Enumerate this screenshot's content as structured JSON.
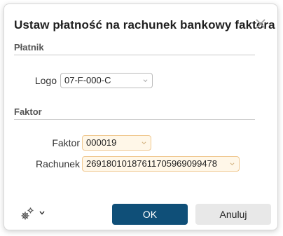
{
  "dialog": {
    "title": "Ustaw płatność na rachunek bankowy faktora",
    "close_icon": "close-icon"
  },
  "sections": {
    "platnik": {
      "label": "Płatnik",
      "logo_label": "Logo",
      "logo_value": "07-F-000-C"
    },
    "faktor": {
      "label": "Faktor",
      "faktor_label": "Faktor",
      "faktor_value": "000019",
      "rachunek_label": "Rachunek",
      "rachunek_value": "26918010187611705969099478"
    }
  },
  "footer": {
    "settings_icon": "gears-icon",
    "ok_label": "OK",
    "cancel_label": "Anuluj"
  },
  "colors": {
    "primary_button": "#0f4f78",
    "required_field_bg": "#fff7e8",
    "required_field_border": "#f0c890"
  }
}
